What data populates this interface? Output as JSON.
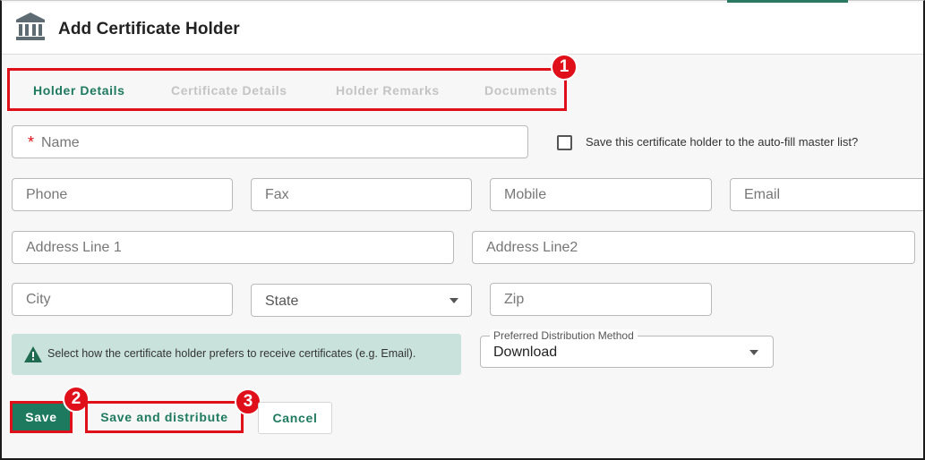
{
  "header": {
    "title": "Add Certificate Holder",
    "icon": "bank-icon"
  },
  "tabs": [
    {
      "label": "Holder Details",
      "active": true
    },
    {
      "label": "Certificate Details",
      "active": false
    },
    {
      "label": "Holder Remarks",
      "active": false
    },
    {
      "label": "Documents",
      "active": false
    }
  ],
  "badges": [
    "1",
    "2",
    "3"
  ],
  "form": {
    "name": {
      "required_mark": "*",
      "label": "Name"
    },
    "autofill_checkbox": {
      "label": "Save this certificate holder to the auto-fill master list?",
      "checked": false
    },
    "phone": {
      "placeholder": "Phone"
    },
    "fax": {
      "placeholder": "Fax"
    },
    "mobile": {
      "placeholder": "Mobile"
    },
    "email": {
      "placeholder": "Email"
    },
    "address1": {
      "placeholder": "Address Line 1"
    },
    "address2": {
      "placeholder": "Address Line2"
    },
    "city": {
      "placeholder": "City"
    },
    "state": {
      "label": "State"
    },
    "zip": {
      "placeholder": "Zip"
    },
    "distribution": {
      "legend": "Preferred Distribution Method",
      "value": "Download"
    }
  },
  "alert": {
    "text": "Select how the certificate holder prefers to receive certificates (e.g. Email).",
    "icon": "warning-icon"
  },
  "buttons": {
    "save": "Save",
    "save_distribute": "Save and distribute",
    "cancel": "Cancel"
  },
  "colors": {
    "accent": "#1e7a5e",
    "highlight": "#e0101a",
    "alert_bg": "#c9e3dc"
  }
}
